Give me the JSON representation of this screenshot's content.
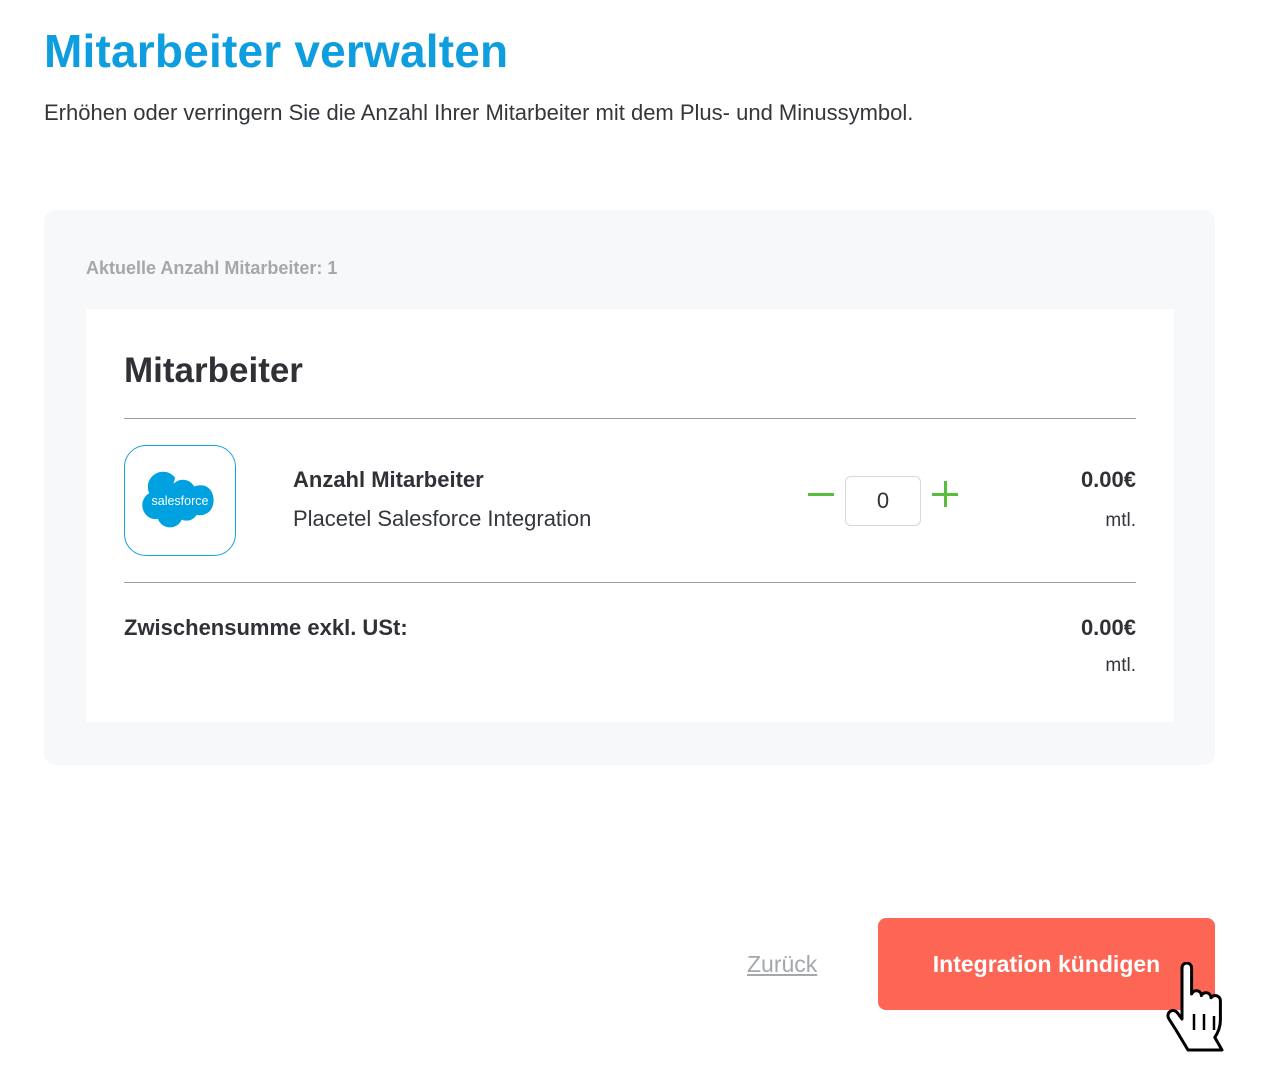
{
  "header": {
    "title": "Mitarbeiter verwalten",
    "subtitle": "Erhöhen oder verringern Sie die Anzahl Ihrer Mitarbeiter mit dem Plus- und Minussymbol."
  },
  "panel": {
    "current_count_label": "Aktuelle Anzahl Mitarbeiter: 1"
  },
  "card": {
    "title": "Mitarbeiter",
    "item": {
      "logo_icon": "salesforce-logo",
      "logo_text": "salesforce",
      "name": "Anzahl Mitarbeiter",
      "description": "Placetel Salesforce Integration",
      "quantity": "0",
      "price": "0.00€",
      "price_unit": "mtl."
    },
    "subtotal": {
      "label": "Zwischensumme exkl. USt:",
      "price": "0.00€",
      "price_unit": "mtl."
    }
  },
  "actions": {
    "back_label": "Zurück",
    "cancel_label": "Integration kündigen"
  },
  "colors": {
    "title_blue": "#0e9ee0",
    "stepper_green": "#57bd3a",
    "cancel_red": "#fd6655",
    "salesforce_blue": "#00a1e0"
  }
}
